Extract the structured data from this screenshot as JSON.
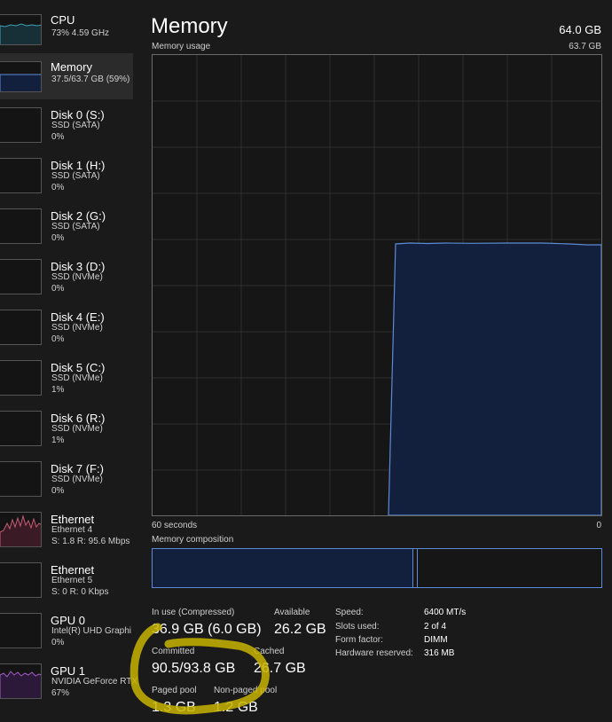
{
  "sidebar": {
    "items": [
      {
        "name": "CPU",
        "sub1": "73%  4.59 GHz",
        "sub2": ""
      },
      {
        "name": "Memory",
        "sub1": "37.5/63.7 GB (59%)",
        "sub2": ""
      },
      {
        "name": "Disk 0 (S:)",
        "sub1": "SSD (SATA)",
        "sub2": "0%"
      },
      {
        "name": "Disk 1 (H:)",
        "sub1": "SSD (SATA)",
        "sub2": "0%"
      },
      {
        "name": "Disk 2 (G:)",
        "sub1": "SSD (SATA)",
        "sub2": "0%"
      },
      {
        "name": "Disk 3 (D:)",
        "sub1": "SSD (NVMe)",
        "sub2": "0%"
      },
      {
        "name": "Disk 4 (E:)",
        "sub1": "SSD (NVMe)",
        "sub2": "0%"
      },
      {
        "name": "Disk 5 (C:)",
        "sub1": "SSD (NVMe)",
        "sub2": "1%"
      },
      {
        "name": "Disk 6 (R:)",
        "sub1": "SSD (NVMe)",
        "sub2": "1%"
      },
      {
        "name": "Disk 7 (F:)",
        "sub1": "SSD (NVMe)",
        "sub2": "0%"
      },
      {
        "name": "Ethernet",
        "sub1": "Ethernet 4",
        "sub2": "S: 1.8  R: 95.6 Mbps"
      },
      {
        "name": "Ethernet",
        "sub1": "Ethernet 5",
        "sub2": "S: 0  R: 0 Kbps"
      },
      {
        "name": "GPU 0",
        "sub1": "Intel(R) UHD Graphi",
        "sub2": "0%"
      },
      {
        "name": "GPU 1",
        "sub1": "NVIDIA GeForce RTX",
        "sub2": "67%"
      }
    ]
  },
  "header": {
    "title": "Memory",
    "total": "64.0 GB"
  },
  "graph": {
    "label": "Memory usage",
    "max_label": "63.7 GB",
    "time_left": "60 seconds",
    "time_right": "0"
  },
  "composition": {
    "label": "Memory composition",
    "in_use_fraction": 0.58,
    "modified_fraction": 0.005
  },
  "stats": {
    "in_use_label": "In use (Compressed)",
    "in_use_value": "36.9 GB (6.0 GB)",
    "available_label": "Available",
    "available_value": "26.2 GB",
    "committed_label": "Committed",
    "committed_value": "90.5/93.8 GB",
    "cached_label": "Cached",
    "cached_value": "26.7 GB",
    "paged_label": "Paged pool",
    "paged_value": "1.3 GB",
    "nonpaged_label": "Non-paged pool",
    "nonpaged_value": "1.2 GB"
  },
  "specs": {
    "speed_label": "Speed:",
    "speed_value": "6400 MT/s",
    "slots_label": "Slots used:",
    "slots_value": "2 of 4",
    "form_label": "Form factor:",
    "form_value": "DIMM",
    "reserved_label": "Hardware reserved:",
    "reserved_value": "316 MB"
  },
  "colors": {
    "memory_line": "#5b8bd6",
    "memory_fill": "#13203d",
    "cpu_line": "#3ea0b5",
    "ethernet_line": "#c45c74",
    "gpu_line": "#a35cc4",
    "annotation": "#c8b400"
  }
}
